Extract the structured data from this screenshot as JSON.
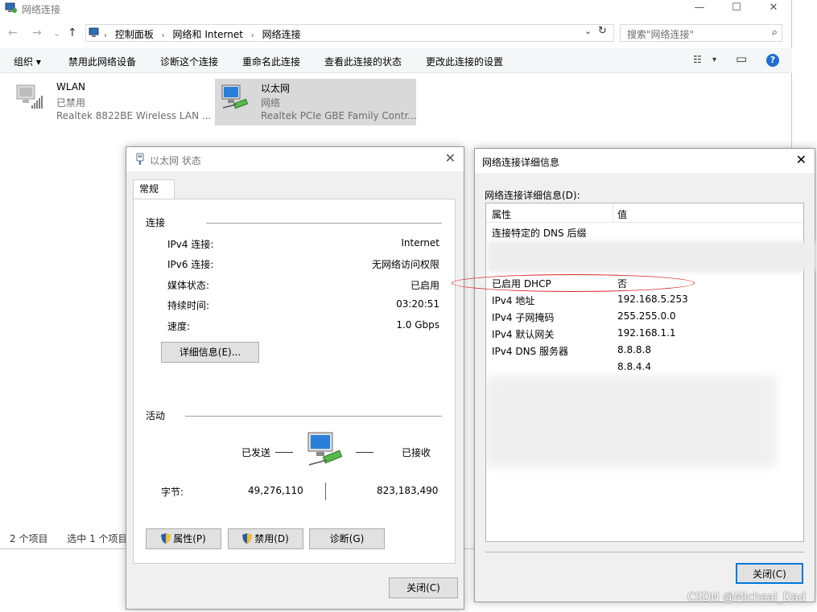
{
  "explorer": {
    "title": "网络连接",
    "window_controls": {
      "minimize": "—",
      "maximize": "☐",
      "close": "✕"
    },
    "nav": {
      "back": "←",
      "forward": "→",
      "recent": "⌄",
      "up": "↑"
    },
    "breadcrumbs": [
      "控制面板",
      "网络和 Internet",
      "网络连接"
    ],
    "breadcrumb_sep": "›",
    "address_dropdown": "⌄",
    "refresh": "↻",
    "search_placeholder": "搜索\"网络连接\"",
    "search_icon": "⌕",
    "commands": [
      "组织 ▾",
      "禁用此网络设备",
      "诊断这个连接",
      "重命名此连接",
      "查看此连接的状态",
      "更改此连接的设置"
    ],
    "view_icons": {
      "change_view": "☷",
      "dropdown": "▾",
      "preview_pane": "▭",
      "help": "?"
    },
    "adapters": [
      {
        "name": "WLAN",
        "status": "已禁用",
        "device": "Realtek 8822BE Wireless LAN ...",
        "icon": "wireless-adapter-icon"
      },
      {
        "name": "以太网",
        "status": "网络",
        "device": "Realtek PCIe GBE Family Contr...",
        "icon": "ethernet-adapter-icon"
      }
    ],
    "status_bar": {
      "count": "2 个项目",
      "selected": "选中 1 个项目"
    }
  },
  "status_dialog": {
    "title": "以太网 状态",
    "close": "✕",
    "tab": "常规",
    "connection_group": "连接",
    "rows": [
      {
        "key": "IPv4 连接:",
        "value": "Internet"
      },
      {
        "key": "IPv6 连接:",
        "value": "无网络访问权限"
      },
      {
        "key": "媒体状态:",
        "value": "已启用"
      },
      {
        "key": "持续时间:",
        "value": "03:20:51"
      },
      {
        "key": "速度:",
        "value": "1.0 Gbps"
      }
    ],
    "details_button": "详细信息(E)...",
    "activity_group": "活动",
    "sent_label": "已发送",
    "received_label": "已接收",
    "bytes_label": "字节:",
    "bytes_sent": "49,276,110",
    "bytes_received": "823,183,490",
    "properties_button": "属性(P)",
    "disable_button": "禁用(D)",
    "diagnose_button": "诊断(G)",
    "close_button": "关闭(C)"
  },
  "detail_dialog": {
    "title": "网络连接详细信息",
    "close": "✕",
    "heading": "网络连接详细信息(D):",
    "col_property": "属性",
    "col_value": "值",
    "rows": [
      {
        "key": "连接特定的 DNS 后缀",
        "value": ""
      },
      {
        "key": "已启用 DHCP",
        "value": "否"
      },
      {
        "key": "IPv4 地址",
        "value": "192.168.5.253"
      },
      {
        "key": "IPv4 子网掩码",
        "value": "255.255.0.0"
      },
      {
        "key": "IPv4 默认网关",
        "value": "192.168.1.1"
      },
      {
        "key": "IPv4 DNS 服务器",
        "value": "8.8.8.8"
      },
      {
        "key": "",
        "value": "8.8.4.4"
      }
    ],
    "close_button": "关闭(C)"
  },
  "annotation_color": "#d9242b",
  "watermark": "CSDN @Micheal_Dad"
}
